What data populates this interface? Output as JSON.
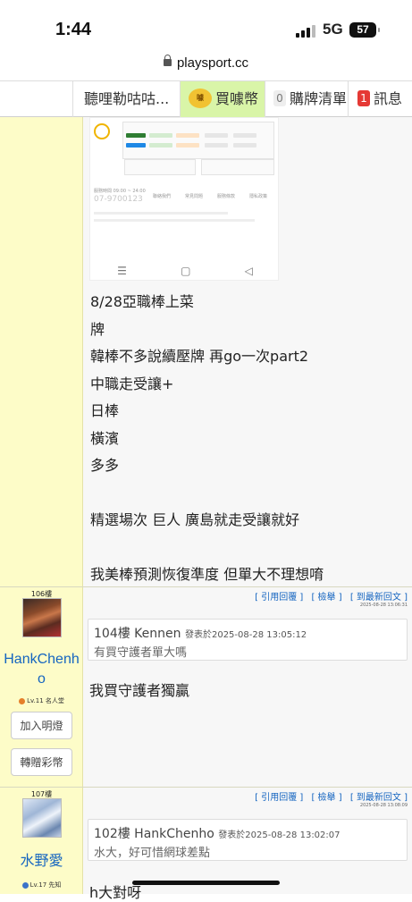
{
  "status": {
    "time": "1:44",
    "network": "5G",
    "battery": "57"
  },
  "browser": {
    "domain": "playsport.cc"
  },
  "nav": {
    "item1": "聽哩勒咕咕...",
    "item2": "買噱幣",
    "item3_count": "0",
    "item3": "購牌清單",
    "item4_count": "1",
    "item4": "訊息"
  },
  "colors": {
    "accent_blue": "#1565c0",
    "sidebar_yellow": "#fdfcc8",
    "nav_green": "#d9f5a8",
    "badge_red": "#e53935"
  },
  "post1": {
    "embedded_screenshot": {
      "hours": "服務時間 09:00 ~ 24:00",
      "phone": "07-9700123",
      "links": [
        "聯絡我們",
        "常見問題",
        "服務條款",
        "隱私政策"
      ]
    },
    "lines": [
      "8/28亞職棒上菜",
      "牌",
      "韓棒不多說續壓牌 再go一次part2",
      "中職走受讓+",
      "日棒",
      "橫濱",
      "多多",
      "",
      "精選場次 巨人 廣島就走受讓就好",
      "",
      "我美棒預測恢復準度 但單大不理想唷"
    ]
  },
  "post2": {
    "floor": "106樓",
    "actions": [
      "[ 引用回覆 ]",
      "[ 檢舉 ]",
      "[ 到最新回文 ]"
    ],
    "timestamp": "2025-08-28 13:06:31",
    "username": "HankChenho",
    "level": "Lv.11 名人堂",
    "btn_follow": "加入明燈",
    "btn_gift": "轉贈彩幣",
    "quote_floor": "104樓 Kennen",
    "quote_meta": "發表於2025-08-28 13:05:12",
    "quote_body": "有買守護者單大嗎",
    "reply": "我買守護者獨贏"
  },
  "post3": {
    "floor": "107樓",
    "actions": [
      "[ 引用回覆 ]",
      "[ 檢舉 ]",
      "[ 到最新回文 ]"
    ],
    "timestamp": "2025-08-28 13:08:09",
    "username": "水野愛",
    "level": "Lv.17 先知",
    "quote_floor": "102樓 HankChenho",
    "quote_meta": "發表於2025-08-28 13:02:07",
    "quote_body": "水大，好可惜網球差點",
    "reply": "h大對呀"
  }
}
